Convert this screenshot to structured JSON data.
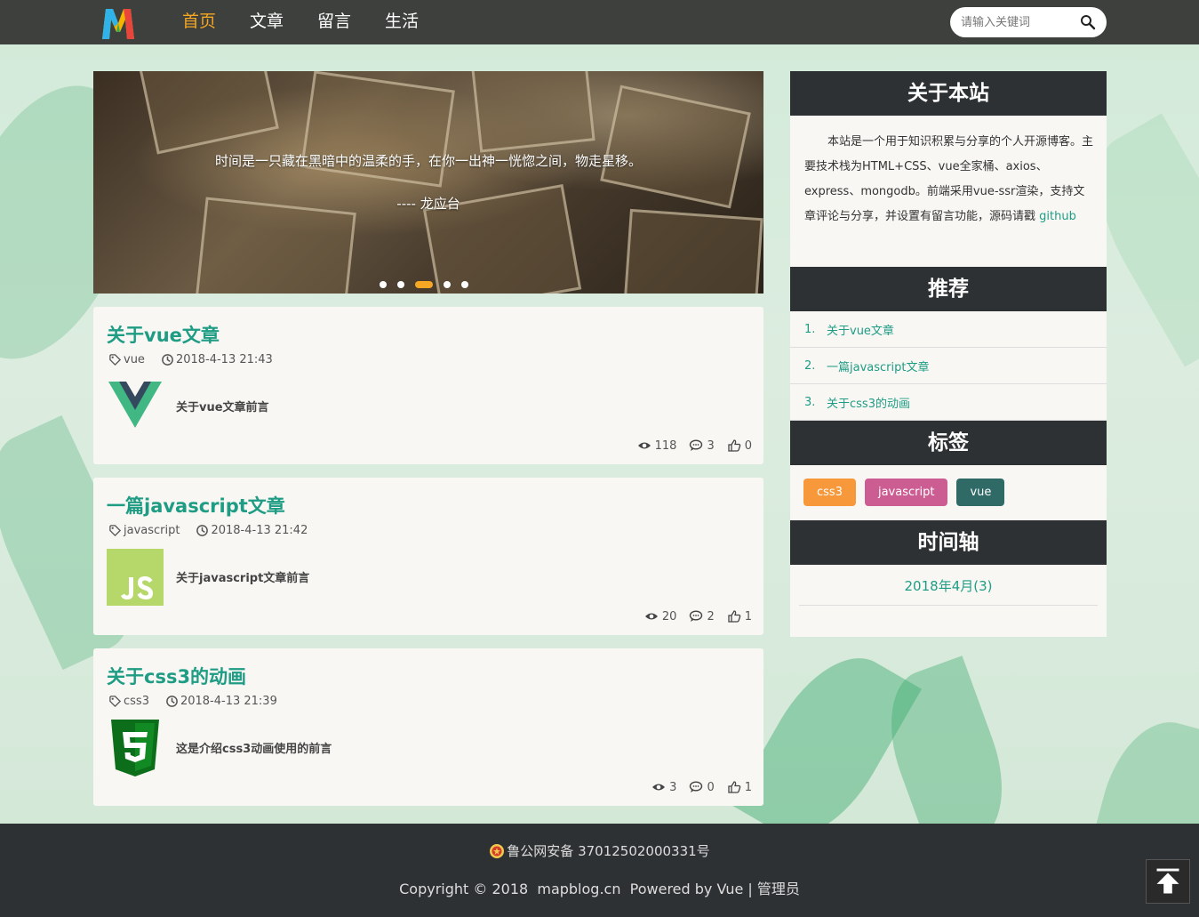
{
  "header": {
    "logo_icon": "m-logo-icon",
    "nav": [
      "首页",
      "文章",
      "留言",
      "生活"
    ],
    "active_nav": "首页",
    "search_placeholder": "请输入关键词"
  },
  "carousel": {
    "quote": "时间是一只藏在黑暗中的温柔的手，在你一出神一恍惚之间，物走星移。",
    "author": "---- 龙应台",
    "slide_count": 5,
    "active_slide": 3
  },
  "articles": [
    {
      "title": "关于vue文章",
      "tag": "vue",
      "date": "2018-4-13 21:43",
      "thumb": "vue-logo-icon",
      "excerpt": "关于vue文章前言",
      "views": "118",
      "comments": "3",
      "likes": "0"
    },
    {
      "title": "一篇javascript文章",
      "tag": "javascript",
      "date": "2018-4-13 21:42",
      "thumb": "js-logo-icon",
      "excerpt": "关于javascript文章前言",
      "views": "20",
      "comments": "2",
      "likes": "1"
    },
    {
      "title": "关于css3的动画",
      "tag": "css3",
      "date": "2018-4-13 21:39",
      "thumb": "css3-logo-icon",
      "excerpt": "这是介绍css3动画使用的前言",
      "views": "3",
      "comments": "0",
      "likes": "1"
    }
  ],
  "sidebar": {
    "about": {
      "title": "关于本站",
      "text": "本站是一个用于知识积累与分享的个人开源博客。主要技术栈为HTML+CSS、vue全家桶、axios、express、mongodb。前端采用vue-ssr渲染，支持文章评论与分享，并设置有留言功能，源码请戳",
      "link": "github"
    },
    "recommend": {
      "title": "推荐",
      "items": [
        {
          "num": "1.",
          "label": "关于vue文章"
        },
        {
          "num": "2.",
          "label": "一篇javascript文章"
        },
        {
          "num": "3.",
          "label": "关于css3的动画"
        }
      ]
    },
    "tags": {
      "title": "标签",
      "items": [
        {
          "label": "css3",
          "color": "#f7983a"
        },
        {
          "label": "javascript",
          "color": "#cc5d92"
        },
        {
          "label": "vue",
          "color": "#2f6a67"
        }
      ]
    },
    "timeline": {
      "title": "时间轴",
      "items": [
        "2018年4月(3)"
      ]
    }
  },
  "footer": {
    "beian": "鲁公网安备 37012502000331号",
    "copyright_prefix": "Copyright © 2018  mapblog.cn  Powered by ",
    "powered": "Vue",
    "separator": " | ",
    "admin": "管理员"
  },
  "colors": {
    "accent": "#1f9c84",
    "nav_active": "#f5a623",
    "header_bg": "#3d403d",
    "panel_head_bg": "#2e3133"
  }
}
